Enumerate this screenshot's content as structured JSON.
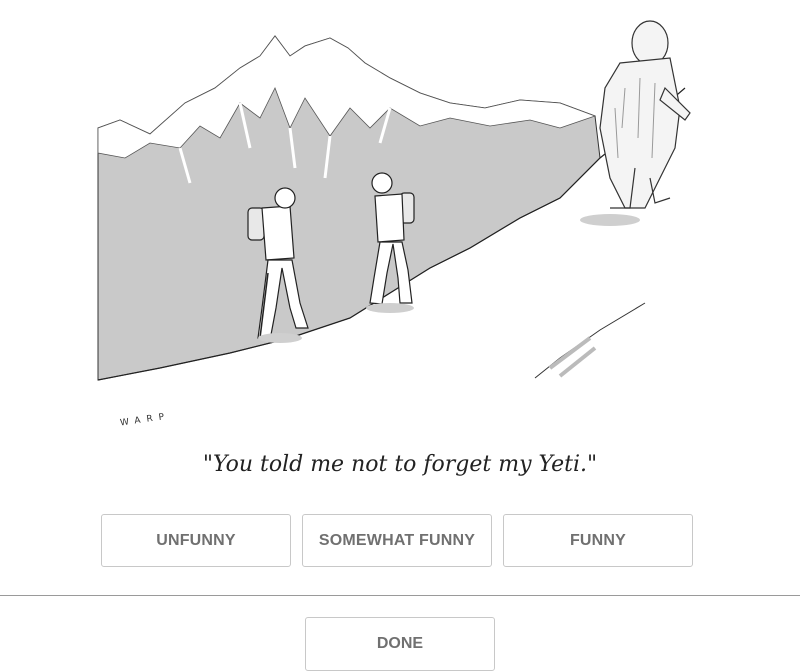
{
  "cartoon": {
    "signature": "WARP",
    "caption": "\"You told me not to forget my Yeti.\""
  },
  "ratings": {
    "unfunny_label": "UNFUNNY",
    "somewhat_funny_label": "SOMEWHAT FUNNY",
    "funny_label": "FUNNY"
  },
  "footer": {
    "done_label": "DONE"
  }
}
